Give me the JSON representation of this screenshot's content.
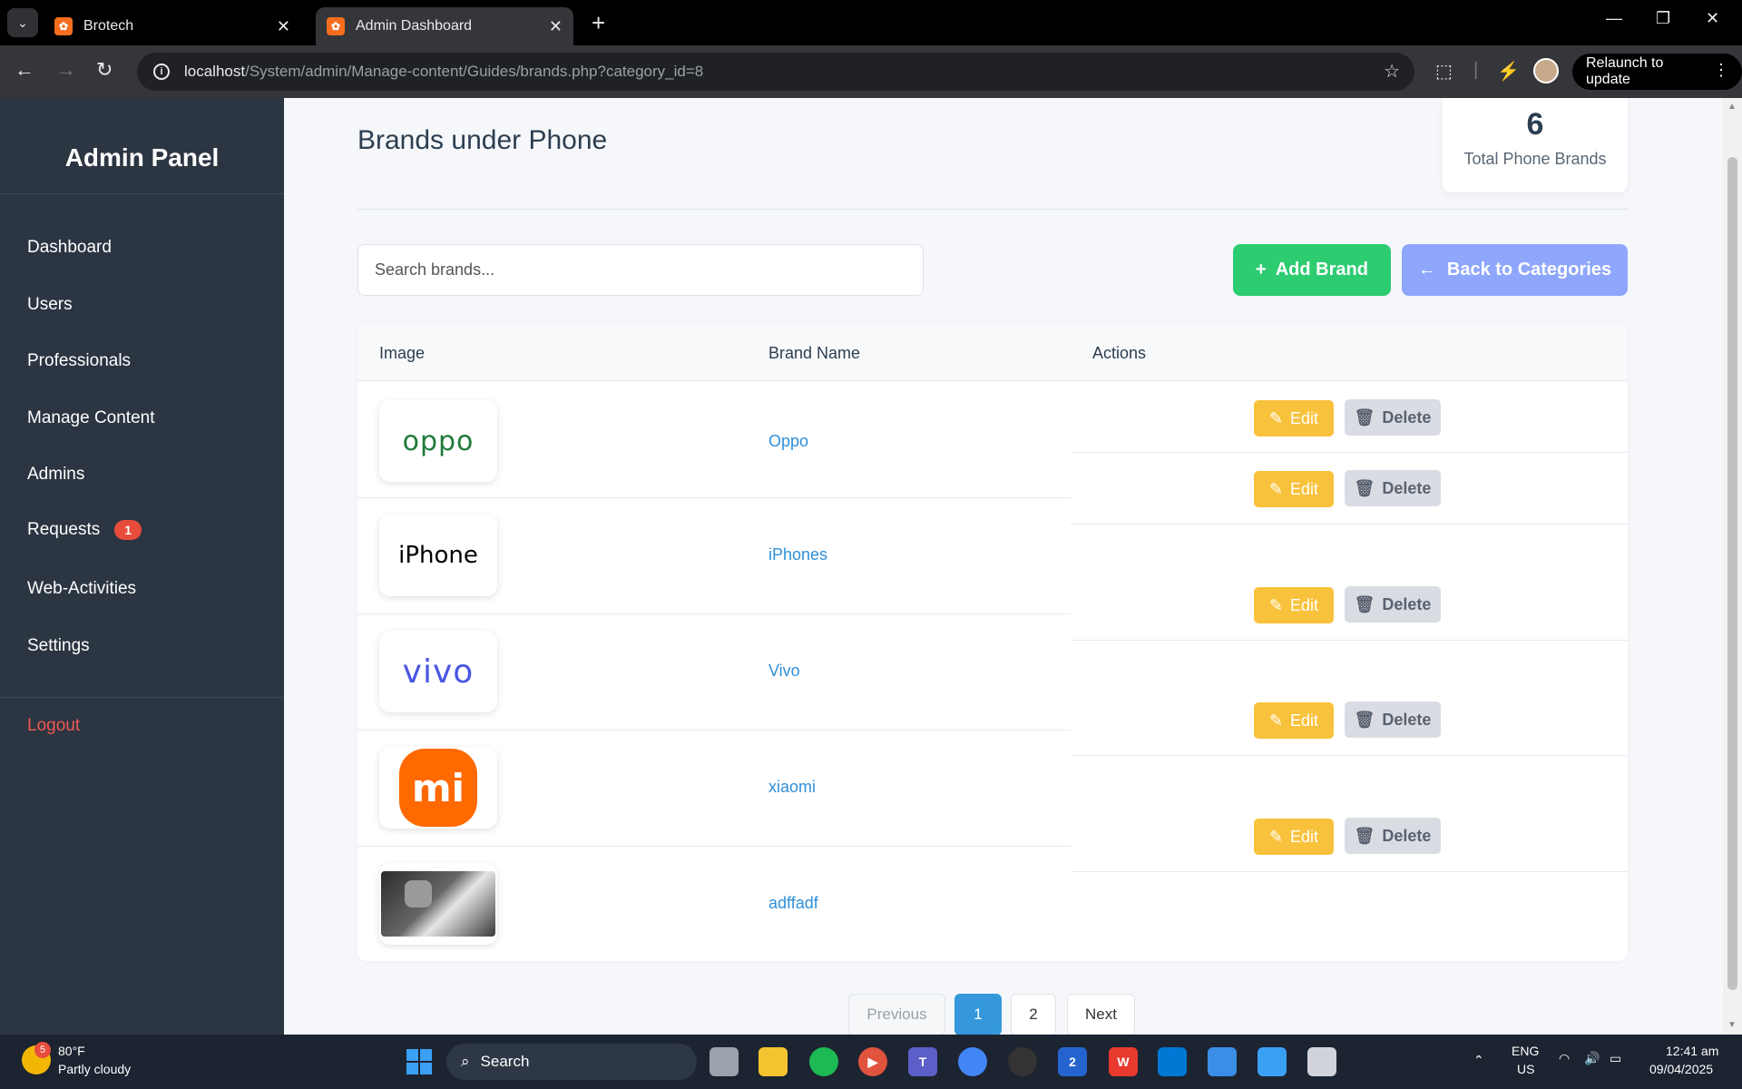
{
  "browser": {
    "tabs": [
      {
        "title": "Brotech",
        "active": false
      },
      {
        "title": "Admin Dashboard",
        "active": true
      }
    ],
    "url_host": "localhost",
    "url_path": "/System/admin/Manage-content/Guides/brands.php?category_id=8",
    "relaunch_label": "Relaunch to update"
  },
  "sidebar": {
    "title": "Admin Panel",
    "items": [
      {
        "label": "Dashboard"
      },
      {
        "label": "Users"
      },
      {
        "label": "Professionals"
      },
      {
        "label": "Manage Content"
      },
      {
        "label": "Admins"
      },
      {
        "label": "Requests",
        "badge": "1"
      },
      {
        "label": "Web-Activities"
      },
      {
        "label": "Settings"
      }
    ],
    "logout": "Logout"
  },
  "main": {
    "title": "Brands under Phone",
    "stat": {
      "value": "6",
      "label": "Total Phone Brands"
    },
    "search_placeholder": "Search brands...",
    "add_button": "Add Brand",
    "back_button": "Back to Categories",
    "columns": [
      "Image",
      "Brand Name",
      "Actions"
    ],
    "rows": [
      {
        "name": "Oppo",
        "logo_text": "oppo"
      },
      {
        "name": "iPhones",
        "logo_text": "iPhone"
      },
      {
        "name": "Vivo",
        "logo_text": "vivo"
      },
      {
        "name": "xiaomi",
        "logo_text": "mi"
      },
      {
        "name": "adffadf",
        "logo_text": ""
      }
    ],
    "edit_label": "Edit",
    "delete_label": "Delete",
    "pagination": {
      "previous": "Previous",
      "pages": [
        "1",
        "2"
      ],
      "current": "1",
      "next": "Next"
    }
  },
  "taskbar": {
    "weather_temp": "80°F",
    "weather_desc": "Partly cloudy",
    "weather_badge": "5",
    "search_label": "Search",
    "todo_badge": "2",
    "lang_top": "ENG",
    "lang_bottom": "US",
    "time": "12:41 am",
    "date": "09/04/2025"
  },
  "colors": {
    "sidebar_bg": "#2c3542",
    "add_button": "#2ecc71",
    "back_button": "#8ea6fb",
    "edit_button": "#f9c23c",
    "delete_button": "#d9dde3",
    "link": "#2f8fd8",
    "badge": "#e74c3c",
    "pager_active": "#3498db"
  }
}
